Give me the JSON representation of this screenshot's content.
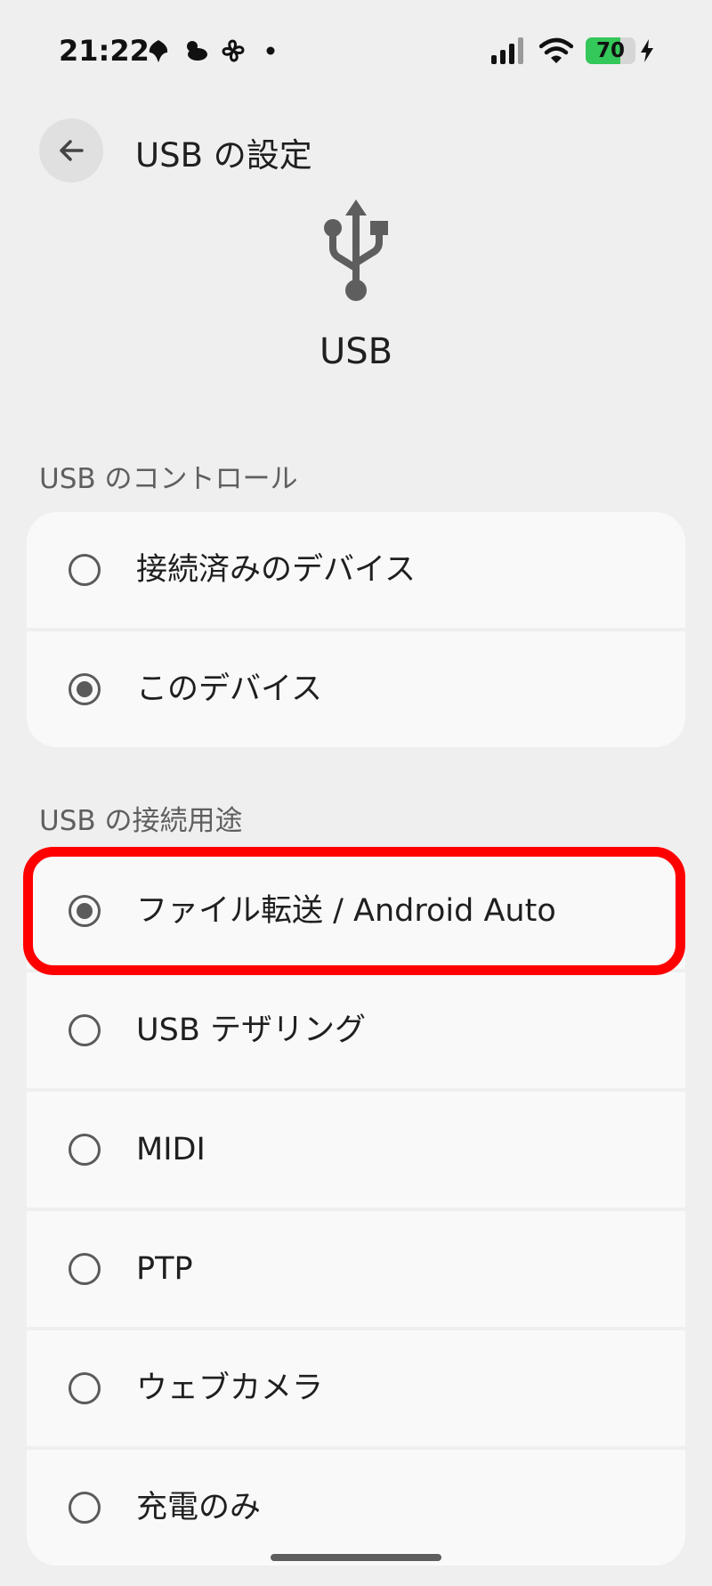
{
  "status_bar": {
    "time": "21:22",
    "notification_icons": [
      "leaf-icon",
      "cloud-sun-icon",
      "fan-icon",
      "dot-icon"
    ],
    "battery_level": 70,
    "battery_text": "70",
    "charging": true,
    "battery_color": "#34c759"
  },
  "header": {
    "title": "USB の設定",
    "back_icon": "arrow-left-icon"
  },
  "hero": {
    "icon": "usb-icon",
    "label": "USB"
  },
  "usb_control": {
    "heading": "USB のコントロール",
    "options": [
      {
        "label": "接続済みのデバイス",
        "selected": false
      },
      {
        "label": "このデバイス",
        "selected": true
      }
    ]
  },
  "usb_usage": {
    "heading": "USB の接続用途",
    "options": [
      {
        "label": "ファイル転送 / Android Auto",
        "selected": true,
        "highlighted": true
      },
      {
        "label": "USB テザリング",
        "selected": false
      },
      {
        "label": "MIDI",
        "selected": false
      },
      {
        "label": "PTP",
        "selected": false
      },
      {
        "label": "ウェブカメラ",
        "selected": false
      },
      {
        "label": "充電のみ",
        "selected": false
      }
    ]
  },
  "colors": {
    "background": "#efefef",
    "card": "#f9f9f9",
    "highlight": "#ff0000",
    "radio": "#5b5b5b"
  }
}
